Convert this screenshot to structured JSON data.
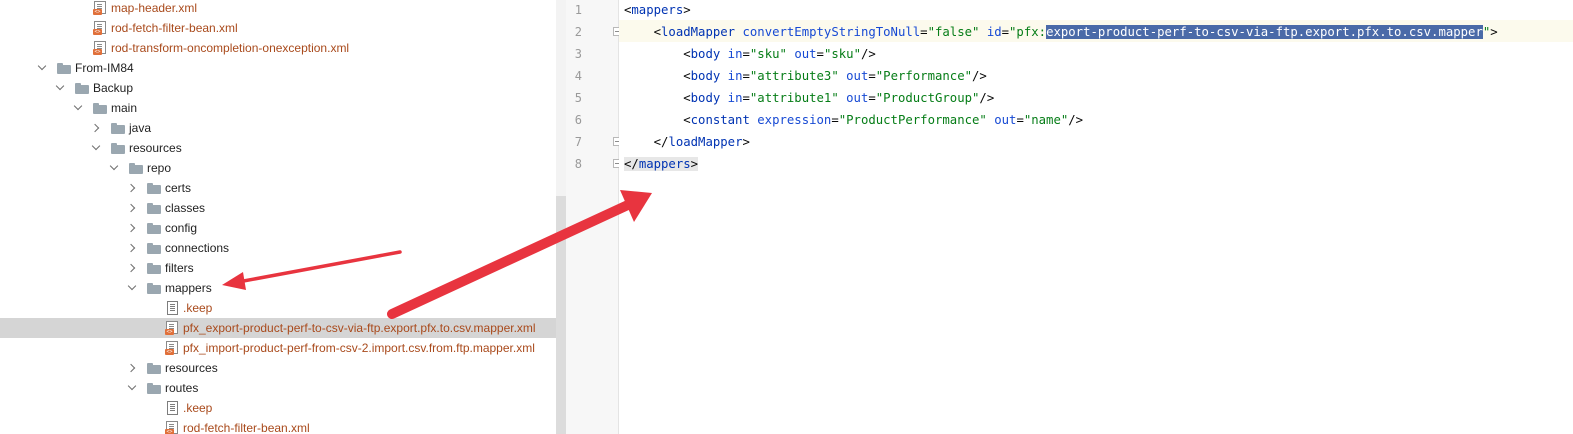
{
  "tree": {
    "items": [
      {
        "label": "map-header.xml",
        "kind": "xml"
      },
      {
        "label": "rod-fetch-filter-bean.xml",
        "kind": "xml"
      },
      {
        "label": "rod-transform-oncompletion-onexception.xml",
        "kind": "xml"
      },
      {
        "label": "From-IM84",
        "kind": "folder"
      },
      {
        "label": "Backup",
        "kind": "folder"
      },
      {
        "label": "main",
        "kind": "folder"
      },
      {
        "label": "java",
        "kind": "folder"
      },
      {
        "label": "resources",
        "kind": "folder"
      },
      {
        "label": "repo",
        "kind": "folder"
      },
      {
        "label": "certs",
        "kind": "folder"
      },
      {
        "label": "classes",
        "kind": "folder"
      },
      {
        "label": "config",
        "kind": "folder"
      },
      {
        "label": "connections",
        "kind": "folder"
      },
      {
        "label": "filters",
        "kind": "folder"
      },
      {
        "label": "mappers",
        "kind": "folder"
      },
      {
        "label": ".keep",
        "kind": "text"
      },
      {
        "label": "pfx_export-product-perf-to-csv-via-ftp.export.pfx.to.csv.mapper.xml",
        "kind": "xml",
        "selected": true
      },
      {
        "label": "pfx_import-product-perf-from-csv-2.import.csv.from.ftp.mapper.xml",
        "kind": "xml"
      },
      {
        "label": "resources",
        "kind": "folder"
      },
      {
        "label": "routes",
        "kind": "folder"
      },
      {
        "label": ".keep",
        "kind": "text"
      },
      {
        "label": "rod-fetch-filter-bean.xml",
        "kind": "xml"
      }
    ]
  },
  "editor": {
    "line_numbers": [
      "1",
      "2",
      "3",
      "4",
      "5",
      "6",
      "7",
      "8"
    ],
    "lines": [
      [
        {
          "t": "<",
          "c": "brk"
        },
        {
          "t": "mappers",
          "c": "tag"
        },
        {
          "t": ">",
          "c": "brk"
        }
      ],
      [
        {
          "t": "    ",
          "c": "brk"
        },
        {
          "t": "<",
          "c": "brk"
        },
        {
          "t": "loadMapper",
          "c": "tag"
        },
        {
          "t": " ",
          "c": "brk"
        },
        {
          "t": "convertEmptyStringToNull",
          "c": "attr"
        },
        {
          "t": "=",
          "c": "brk"
        },
        {
          "t": "\"false\"",
          "c": "val"
        },
        {
          "t": " ",
          "c": "brk"
        },
        {
          "t": "id",
          "c": "attr"
        },
        {
          "t": "=",
          "c": "brk"
        },
        {
          "t": "\"pfx:",
          "c": "val"
        },
        {
          "t": "export-product-perf-to-csv-via-ftp.export.pfx.to.csv.mapper",
          "c": "hl-sel"
        },
        {
          "t": "\"",
          "c": "val"
        },
        {
          "t": ">",
          "c": "brk"
        }
      ],
      [
        {
          "t": "        ",
          "c": "brk"
        },
        {
          "t": "<",
          "c": "brk"
        },
        {
          "t": "body",
          "c": "tag"
        },
        {
          "t": " ",
          "c": "brk"
        },
        {
          "t": "in",
          "c": "attr"
        },
        {
          "t": "=",
          "c": "brk"
        },
        {
          "t": "\"sku\"",
          "c": "val"
        },
        {
          "t": " ",
          "c": "brk"
        },
        {
          "t": "out",
          "c": "attr"
        },
        {
          "t": "=",
          "c": "brk"
        },
        {
          "t": "\"sku\"",
          "c": "val"
        },
        {
          "t": "/>",
          "c": "brk"
        }
      ],
      [
        {
          "t": "        ",
          "c": "brk"
        },
        {
          "t": "<",
          "c": "brk"
        },
        {
          "t": "body",
          "c": "tag"
        },
        {
          "t": " ",
          "c": "brk"
        },
        {
          "t": "in",
          "c": "attr"
        },
        {
          "t": "=",
          "c": "brk"
        },
        {
          "t": "\"attribute3\"",
          "c": "val"
        },
        {
          "t": " ",
          "c": "brk"
        },
        {
          "t": "out",
          "c": "attr"
        },
        {
          "t": "=",
          "c": "brk"
        },
        {
          "t": "\"Performance\"",
          "c": "val"
        },
        {
          "t": "/>",
          "c": "brk"
        }
      ],
      [
        {
          "t": "        ",
          "c": "brk"
        },
        {
          "t": "<",
          "c": "brk"
        },
        {
          "t": "body",
          "c": "tag"
        },
        {
          "t": " ",
          "c": "brk"
        },
        {
          "t": "in",
          "c": "attr"
        },
        {
          "t": "=",
          "c": "brk"
        },
        {
          "t": "\"attribute1\"",
          "c": "val"
        },
        {
          "t": " ",
          "c": "brk"
        },
        {
          "t": "out",
          "c": "attr"
        },
        {
          "t": "=",
          "c": "brk"
        },
        {
          "t": "\"ProductGroup\"",
          "c": "val"
        },
        {
          "t": "/>",
          "c": "brk"
        }
      ],
      [
        {
          "t": "        ",
          "c": "brk"
        },
        {
          "t": "<",
          "c": "brk"
        },
        {
          "t": "constant",
          "c": "tag"
        },
        {
          "t": " ",
          "c": "brk"
        },
        {
          "t": "expression",
          "c": "attr"
        },
        {
          "t": "=",
          "c": "brk"
        },
        {
          "t": "\"ProductPerformance\"",
          "c": "val"
        },
        {
          "t": " ",
          "c": "brk"
        },
        {
          "t": "out",
          "c": "attr"
        },
        {
          "t": "=",
          "c": "brk"
        },
        {
          "t": "\"name\"",
          "c": "val"
        },
        {
          "t": "/>",
          "c": "brk"
        }
      ],
      [
        {
          "t": "    ",
          "c": "brk"
        },
        {
          "t": "</",
          "c": "brk"
        },
        {
          "t": "loadMapper",
          "c": "tag"
        },
        {
          "t": ">",
          "c": "brk"
        }
      ],
      [
        {
          "t": "</",
          "c": "hl-tag"
        },
        {
          "t": "mappers",
          "c": "tag hl-tag"
        },
        {
          "t": ">",
          "c": "hl-tag"
        }
      ]
    ]
  },
  "colors": {
    "xml_file": "#a94a1c",
    "folder": "#9aa7b0",
    "selection": "#4a6aa8",
    "annotation_arrow": "#e8343f"
  }
}
